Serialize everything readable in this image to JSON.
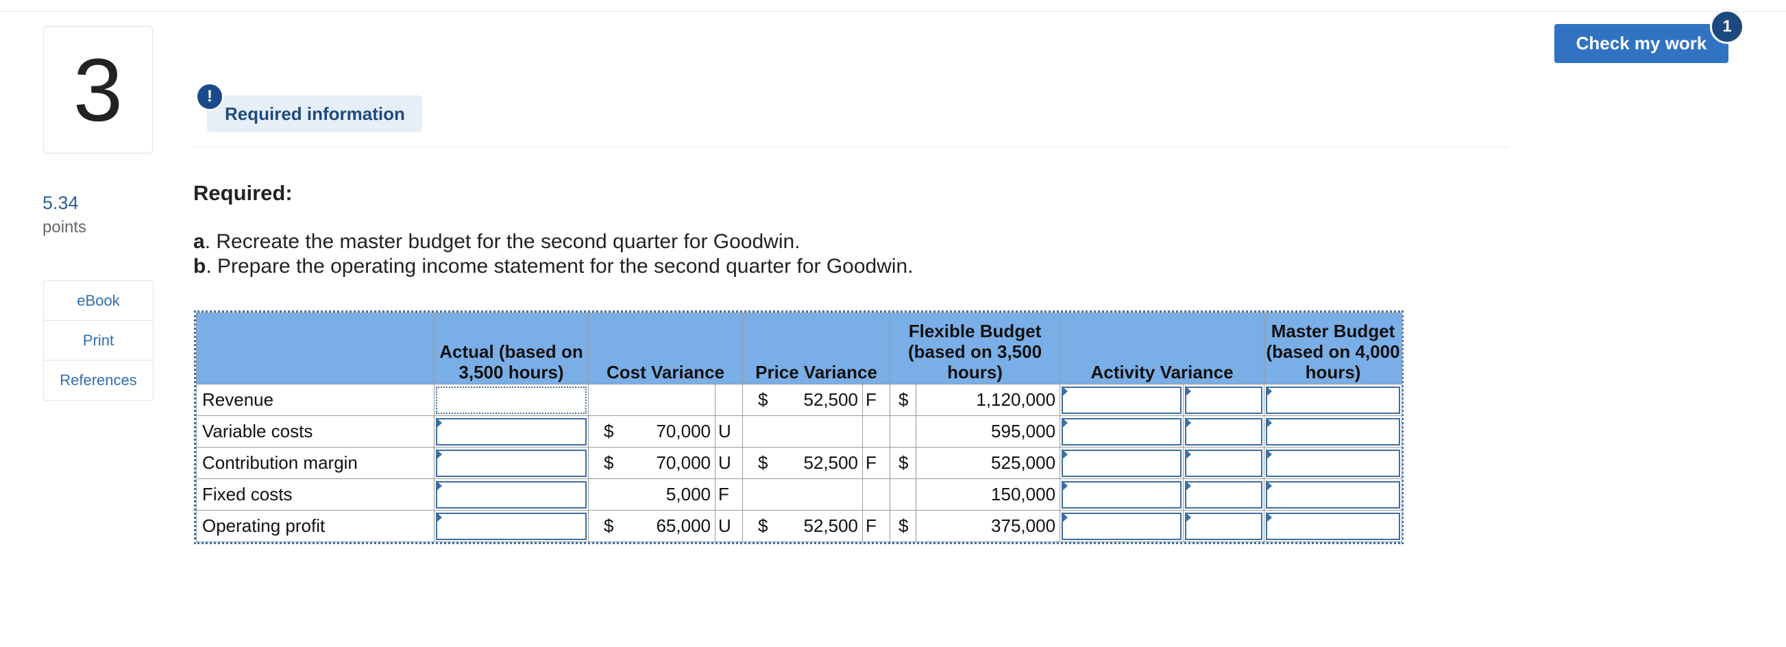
{
  "question": {
    "number": "3",
    "points_value": "5.34",
    "points_label": "points"
  },
  "links": [
    {
      "label": "eBook"
    },
    {
      "label": "Print"
    },
    {
      "label": "References"
    }
  ],
  "check": {
    "label": "Check my work",
    "badge": "1"
  },
  "required_info": {
    "icon": "!",
    "label": "Required information"
  },
  "required_heading": "Required:",
  "instructions": [
    {
      "letter": "a",
      "text": ". Recreate the master budget for the second quarter for Goodwin."
    },
    {
      "letter": "b",
      "text": ". Prepare the operating income statement for the second quarter for Goodwin."
    }
  ],
  "table": {
    "headers": {
      "actual": "Actual (based on 3,500 hours)",
      "cost_variance": "Cost Variance",
      "price_variance": "Price Variance",
      "flexible": "Flexible Budget (based on 3,500 hours)",
      "activity_variance": "Activity Variance",
      "master": "Master Budget (based on 4,000 hours)"
    },
    "rows": [
      {
        "label": "Revenue",
        "cost_dollar": "",
        "cost_value": "",
        "cost_ind": "",
        "price_dollar": "$",
        "price_value": "52,500",
        "price_ind": "F",
        "flex_dollar": "$",
        "flex_value": "1,120,000"
      },
      {
        "label": "Variable costs",
        "cost_dollar": "$",
        "cost_value": "70,000",
        "cost_ind": "U",
        "price_dollar": "",
        "price_value": "",
        "price_ind": "",
        "flex_dollar": "",
        "flex_value": "595,000"
      },
      {
        "label": "Contribution margin",
        "cost_dollar": "$",
        "cost_value": "70,000",
        "cost_ind": "U",
        "price_dollar": "$",
        "price_value": "52,500",
        "price_ind": "F",
        "flex_dollar": "$",
        "flex_value": "525,000"
      },
      {
        "label": "Fixed costs",
        "cost_dollar": "",
        "cost_value": "5,000",
        "cost_ind": "F",
        "price_dollar": "",
        "price_value": "",
        "price_ind": "",
        "flex_dollar": "",
        "flex_value": "150,000"
      },
      {
        "label": "Operating profit",
        "cost_dollar": "$",
        "cost_value": "65,000",
        "cost_ind": "U",
        "price_dollar": "$",
        "price_value": "52,500",
        "price_ind": "F",
        "flex_dollar": "$",
        "flex_value": "375,000"
      }
    ]
  }
}
